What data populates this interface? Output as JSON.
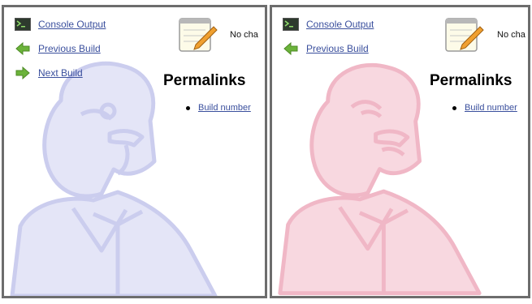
{
  "panels": [
    {
      "id": "left",
      "theme_color": "#c9cbee",
      "nav": [
        {
          "label": "Console Output",
          "icon": "terminal-icon"
        },
        {
          "label": "Previous Build",
          "icon": "arrow-left-icon"
        },
        {
          "label": "Next Build",
          "icon": "arrow-right-icon"
        }
      ],
      "changes_text": "No cha",
      "permalinks_title": "Permalinks",
      "permalink_item": "Build number"
    },
    {
      "id": "right",
      "theme_color": "#f2b7c6",
      "nav": [
        {
          "label": "Console Output",
          "icon": "terminal-icon"
        },
        {
          "label": "Previous Build",
          "icon": "arrow-left-icon"
        }
      ],
      "changes_text": "No cha",
      "permalinks_title": "Permalinks",
      "permalink_item": "Build number"
    }
  ],
  "colors": {
    "link": "#3a4f9d",
    "frame_border": "#6d6d6d",
    "arrow_green": "#6bb33a"
  }
}
